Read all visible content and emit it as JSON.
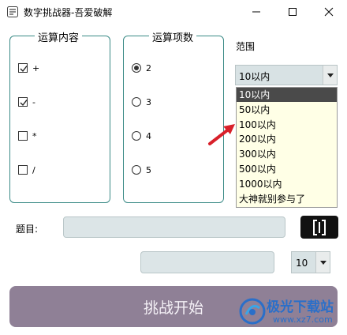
{
  "window": {
    "title": "数字挑战器-吾爱破解"
  },
  "operations": {
    "title": "运算内容",
    "items": [
      {
        "label": "+",
        "checked": true
      },
      {
        "label": "-",
        "checked": true
      },
      {
        "label": "*",
        "checked": false
      },
      {
        "label": "/",
        "checked": false
      }
    ]
  },
  "operand_count": {
    "title": "运算项数",
    "items": [
      {
        "label": "2",
        "selected": true
      },
      {
        "label": "3",
        "selected": false
      },
      {
        "label": "4",
        "selected": false
      },
      {
        "label": "5",
        "selected": false
      }
    ]
  },
  "range": {
    "label": "范围",
    "selected": "10以内",
    "options": [
      "10以内",
      "50以内",
      "100以内",
      "200以内",
      "300以内",
      "500以内",
      "1000以内",
      "大神就别参与了"
    ]
  },
  "question": {
    "label": "题目:",
    "value": ""
  },
  "answer": {
    "value": ""
  },
  "count": {
    "selected": "10"
  },
  "start_button": {
    "label": "挑战开始"
  },
  "watermark": {
    "text": "极光下载站",
    "url": "www.xz7.com"
  },
  "colors": {
    "group_border": "#3a8a86",
    "field_bg": "#dce5e7",
    "start_button_bg": "#8f8096",
    "dropdown_bg": "#ffffe6",
    "selected_bg": "#4a4a4a"
  }
}
